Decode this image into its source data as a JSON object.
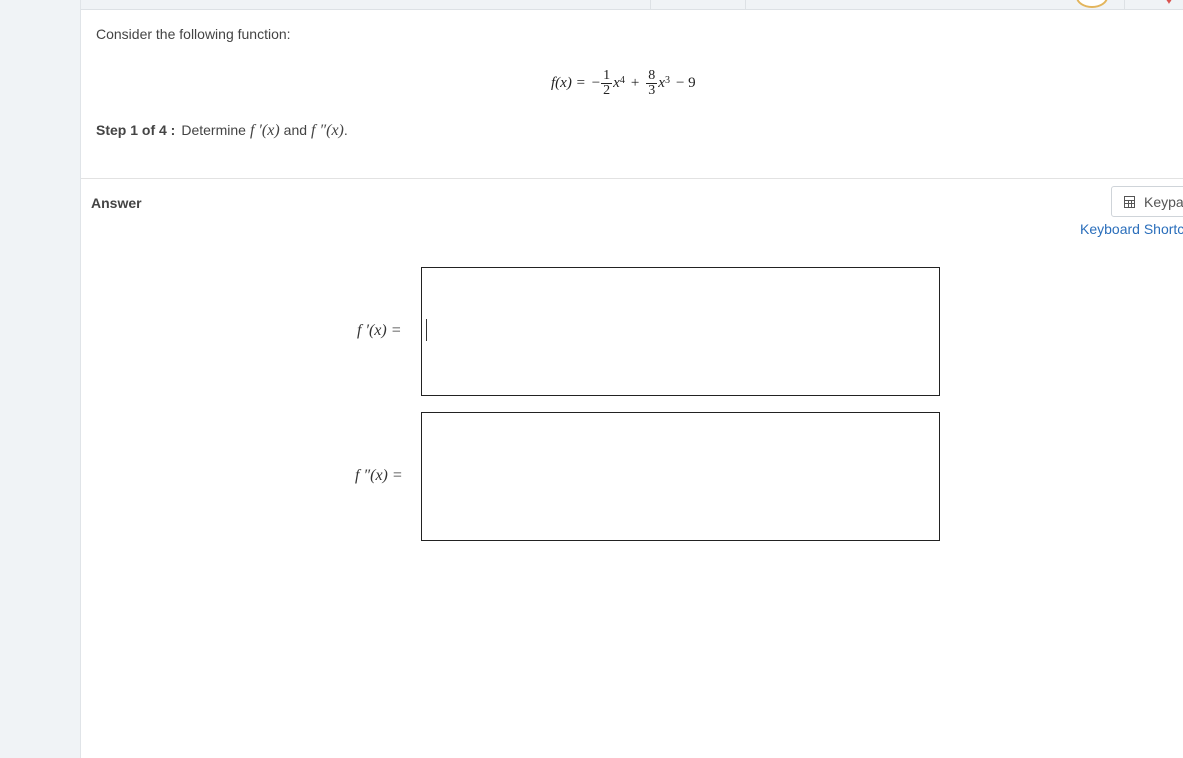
{
  "prompt": "Consider the following function:",
  "formula": {
    "lhs": "f(x) =",
    "minus": "−",
    "term1_num": "1",
    "term1_den": "2",
    "term1_var": "x",
    "term1_exp": "4",
    "plus": "+",
    "term2_num": "8",
    "term2_den": "3",
    "term2_var": "x",
    "term2_exp": "3",
    "tail": "− 9"
  },
  "step": {
    "label": "Step 1 of 4 :",
    "text": "Determine",
    "fprime": "f ′(x)",
    "and": "and",
    "fdouble": "f ″(x)",
    "period": "."
  },
  "answer": {
    "label": "Answer",
    "keypad_label": "Keypad",
    "shortcuts_label": "Keyboard Shortcuts",
    "fields": [
      {
        "label": "f ′(x) =",
        "value": ""
      },
      {
        "label": "f ″(x) =",
        "value": ""
      }
    ]
  },
  "icons": {
    "keypad": "calculator-icon"
  }
}
